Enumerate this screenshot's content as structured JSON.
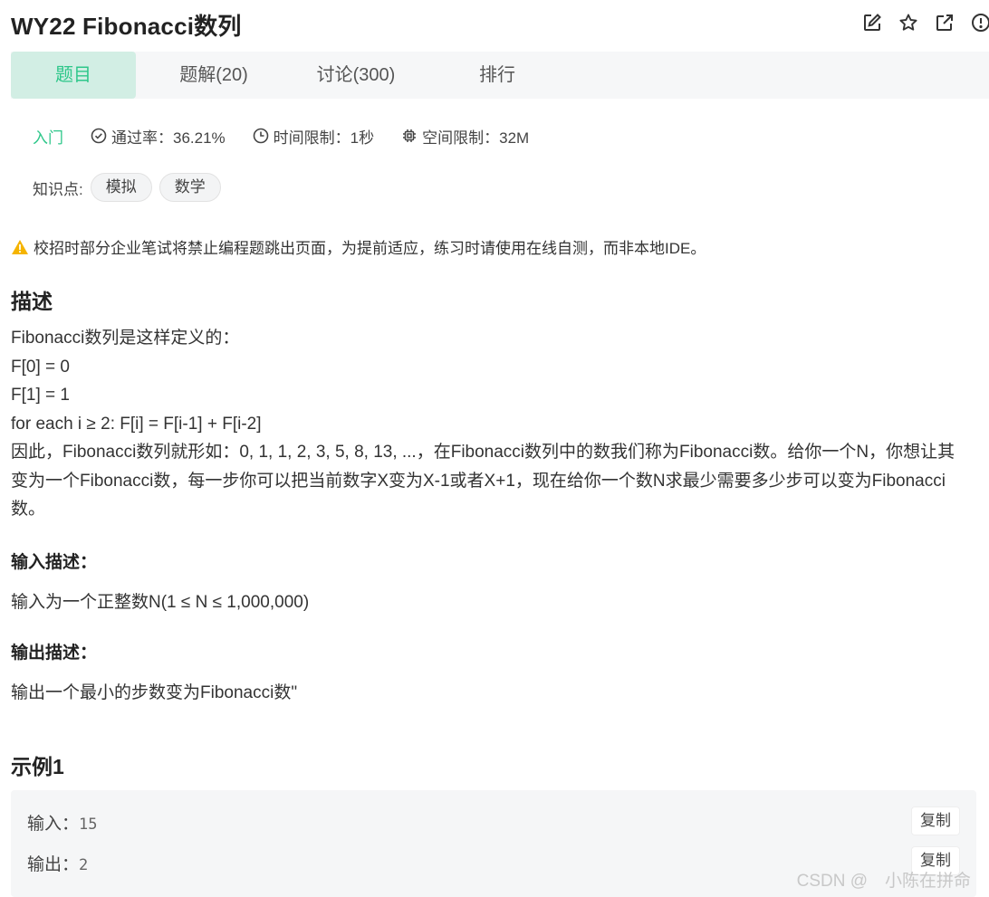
{
  "title": "WY22  Fibonacci数列",
  "title_icons": [
    "edit-icon",
    "star-icon",
    "share-icon",
    "info-icon"
  ],
  "tabs": [
    {
      "label": "题目",
      "active": true
    },
    {
      "label": "题解(20)",
      "active": false
    },
    {
      "label": "讨论(300)",
      "active": false
    },
    {
      "label": "排行",
      "active": false
    }
  ],
  "meta": {
    "level": "入门",
    "pass_rate": "通过率：36.21%",
    "time_limit": "时间限制：1秒",
    "memory_limit": "空间限制：32M"
  },
  "knowledge": {
    "label": "知识点:",
    "tags": [
      "模拟",
      "数学"
    ]
  },
  "warning": "校招时部分企业笔试将禁止编程题跳出页面，为提前适应，练习时请使用在线自测，而非本地IDE。",
  "description": {
    "heading": "描述",
    "lines": [
      "Fibonacci数列是这样定义的：",
      "F[0] = 0",
      "F[1] = 1",
      "for each i ≥ 2: F[i] = F[i-1] + F[i-2]",
      "因此，Fibonacci数列就形如：0, 1, 1, 2, 3, 5, 8, 13, ...，在Fibonacci数列中的数我们称为Fibonacci数。给你一个N，你想让其变为一个Fibonacci数，每一步你可以把当前数字X变为X-1或者X+1，现在给你一个数N求最少需要多少步可以变为Fibonacci数。"
    ]
  },
  "input_desc": {
    "heading": "输入描述：",
    "text": "输入为一个正整数N(1 ≤ N ≤ 1,000,000)"
  },
  "output_desc": {
    "heading": "输出描述：",
    "text": "输出一个最小的步数变为Fibonacci数\""
  },
  "example": {
    "heading": "示例1",
    "input_label": "输入：",
    "input_value": "15",
    "output_label": "输出：",
    "output_value": "2",
    "copy_label": "复制"
  },
  "watermark": "CSDN @　小陈在拼命",
  "colors": {
    "accent": "#2ec78a",
    "tab_active_bg": "#d2eee4",
    "warning": "#f5b400"
  }
}
